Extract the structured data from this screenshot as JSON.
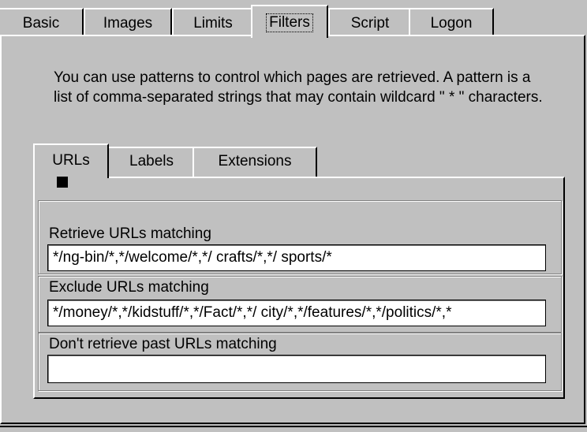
{
  "tabs": [
    {
      "label": "Basic"
    },
    {
      "label": "Images"
    },
    {
      "label": "Limits"
    },
    {
      "label": "Filters"
    },
    {
      "label": "Script"
    },
    {
      "label": "Logon"
    }
  ],
  "selected_tab": "Filters",
  "description": "You can use patterns to control which pages are retrieved. A pattern is a list of comma-separated strings that may contain wildcard \" * \" characters.",
  "subtabs": [
    {
      "label": "URLs"
    },
    {
      "label": "Labels"
    },
    {
      "label": "Extensions"
    }
  ],
  "selected_subtab": "URLs",
  "retrieve": {
    "label": "Retrieve URLs matching",
    "value": "*/ng-bin/*,*/welcome/*,*/ crafts/*,*/ sports/*"
  },
  "exclude": {
    "label": "Exclude URLs matching",
    "value": "*/money/*,*/kidstuff/*,*/Fact/*,*/ city/*,*/features/*,*/politics/*,*"
  },
  "dont_retrieve": {
    "label": "Don't retrieve past URLs matching",
    "value": ""
  }
}
